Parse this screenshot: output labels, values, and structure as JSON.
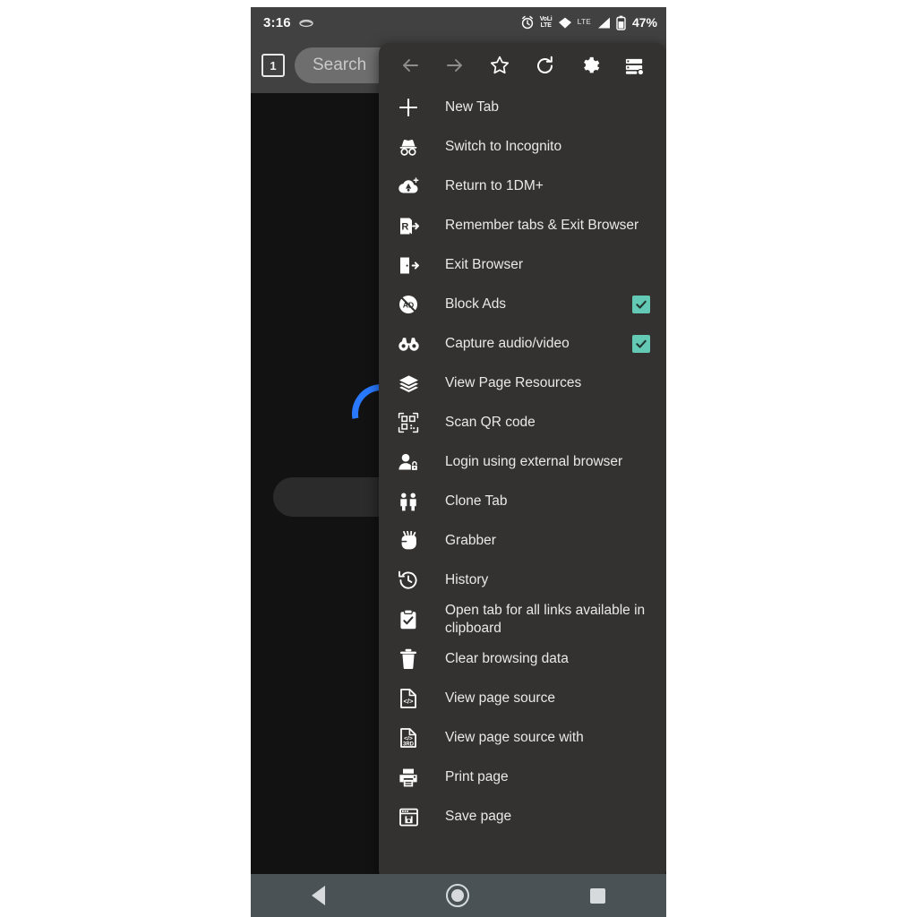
{
  "statusbar": {
    "clock": "3:16",
    "left_icons": [
      "music-icon"
    ],
    "right_icons": [
      "alarm-icon",
      "volte-icon",
      "wifi-icon",
      "lte-label",
      "signal-icon",
      "battery-icon"
    ],
    "volte_top": "VoLi",
    "volte_bottom": "LTE",
    "lte_label": "LTE",
    "battery_percent": "47%"
  },
  "browser_chrome": {
    "tab_count": "1",
    "omnibox_placeholder": "Search",
    "omnibox_value": ""
  },
  "page": {
    "loading_spinner_color": "#2979ff"
  },
  "menu": {
    "background": "#333230",
    "checkbox_color": "#63c9b4",
    "toolbar": [
      {
        "name": "back-icon",
        "label": "Back",
        "enabled": false
      },
      {
        "name": "forward-icon",
        "label": "Forward",
        "enabled": false
      },
      {
        "name": "bookmark-star-icon",
        "label": "Bookmark",
        "enabled": true
      },
      {
        "name": "refresh-icon",
        "label": "Refresh",
        "enabled": true
      },
      {
        "name": "gear-icon",
        "label": "Settings",
        "enabled": true
      },
      {
        "name": "server-list-icon",
        "label": "Downloads",
        "enabled": true
      }
    ],
    "items": [
      {
        "label": "New Tab",
        "icon": "plus-icon"
      },
      {
        "label": "Switch to Incognito",
        "icon": "incognito-hat-icon"
      },
      {
        "label": "Return to 1DM+",
        "icon": "cloud-download-icon"
      },
      {
        "label": "Remember tabs & Exit Browser",
        "icon": "remember-tabs-exit-icon"
      },
      {
        "label": "Exit Browser",
        "icon": "exit-door-icon"
      },
      {
        "label": "Block Ads",
        "icon": "no-ads-icon",
        "checkbox": true
      },
      {
        "label": "Capture audio/video",
        "icon": "binoculars-icon",
        "checkbox": true
      },
      {
        "label": "View Page Resources",
        "icon": "layers-icon"
      },
      {
        "label": "Scan QR code",
        "icon": "qr-code-icon"
      },
      {
        "label": "Login using external browser",
        "icon": "person-lock-icon"
      },
      {
        "label": "Clone Tab",
        "icon": "two-people-icon"
      },
      {
        "label": "Grabber",
        "icon": "fist-icon"
      },
      {
        "label": "History",
        "icon": "history-clock-icon"
      },
      {
        "label": "Open tab for all links available in clipboard",
        "icon": "clipboard-check-icon"
      },
      {
        "label": "Clear browsing data",
        "icon": "trash-icon"
      },
      {
        "label": "View page source",
        "icon": "file-code-icon"
      },
      {
        "label": "View page source with",
        "icon": "file-code-3rd-icon"
      },
      {
        "label": "Print page",
        "icon": "printer-icon"
      },
      {
        "label": "Save page",
        "icon": "save-window-icon"
      }
    ]
  },
  "navbar": {
    "buttons": [
      {
        "name": "nav-back-button",
        "label": "Back"
      },
      {
        "name": "nav-home-button",
        "label": "Home"
      },
      {
        "name": "nav-recents-button",
        "label": "Recents"
      }
    ]
  }
}
